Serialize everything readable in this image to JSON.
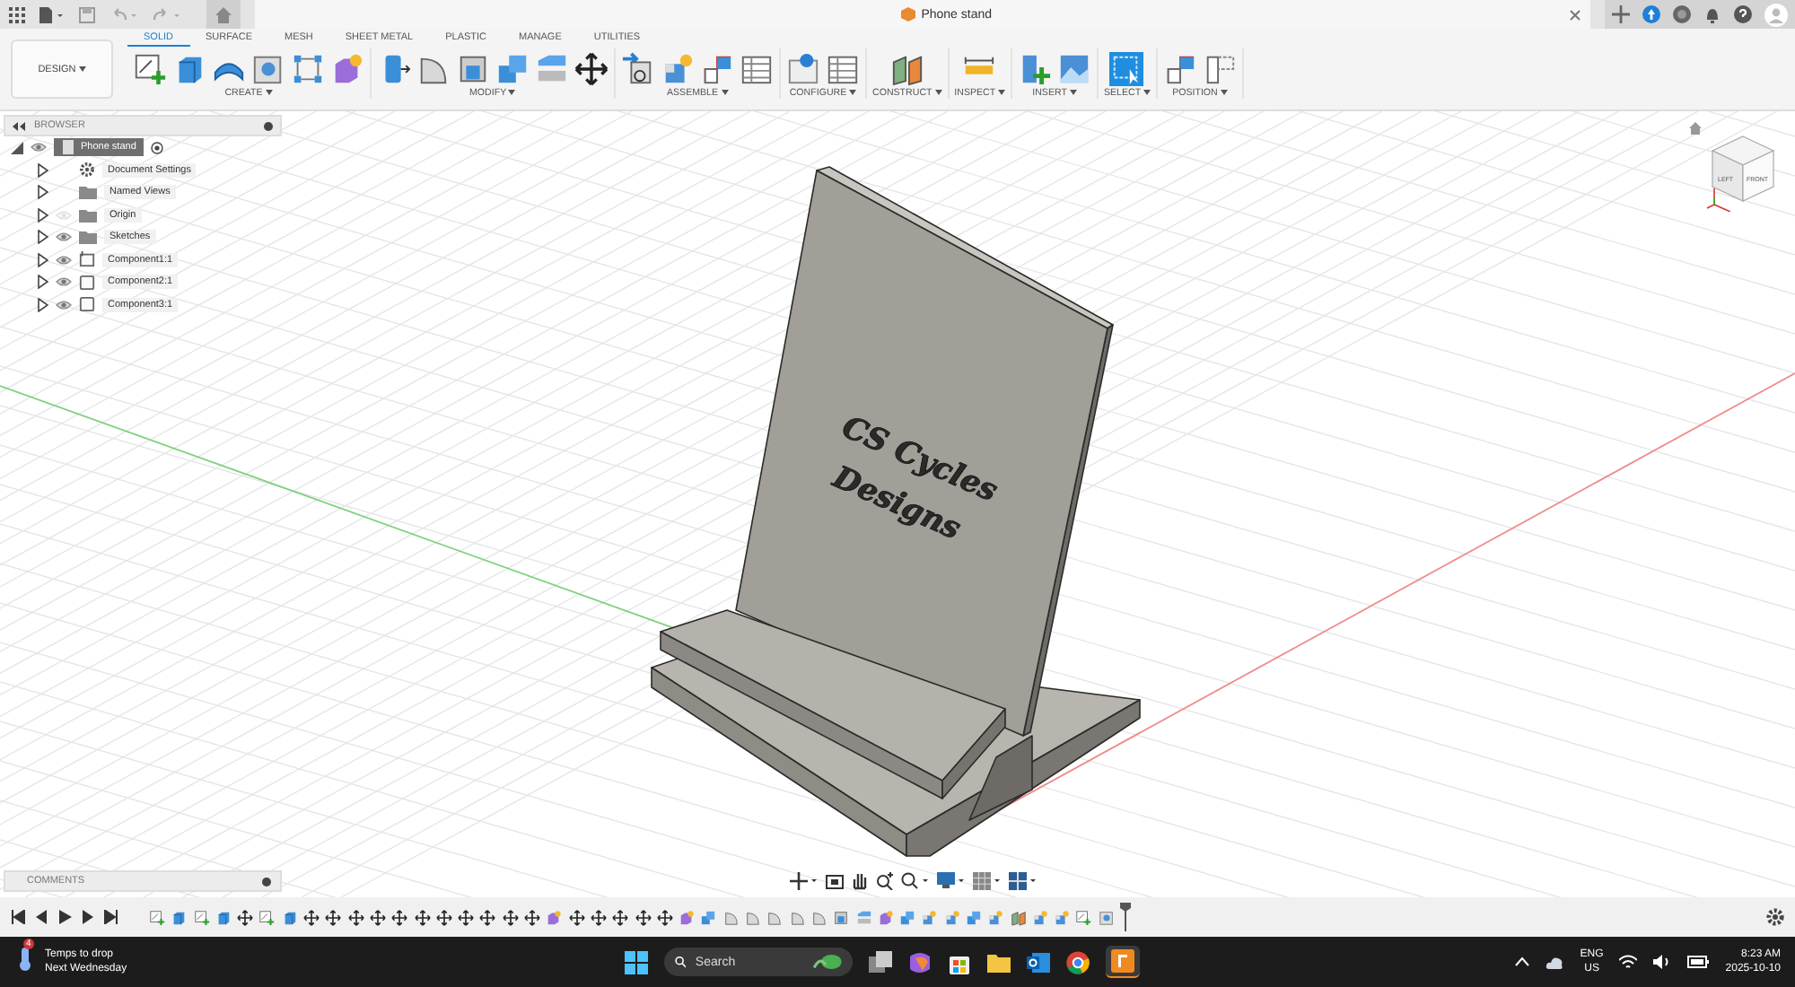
{
  "app_bar": {
    "document_title": "Phone stand"
  },
  "workspace": {
    "label": "DESIGN"
  },
  "tabs": [
    {
      "label": "SOLID",
      "selected": true
    },
    {
      "label": "SURFACE",
      "selected": false
    },
    {
      "label": "MESH",
      "selected": false
    },
    {
      "label": "SHEET METAL",
      "selected": false
    },
    {
      "label": "PLASTIC",
      "selected": false
    },
    {
      "label": "MANAGE",
      "selected": false
    },
    {
      "label": "UTILITIES",
      "selected": false
    }
  ],
  "toolbar_groups": [
    {
      "label": "CREATE",
      "tools": [
        {
          "kind": "sketch"
        },
        {
          "kind": "extrude"
        },
        {
          "kind": "revolve"
        },
        {
          "kind": "hole"
        },
        {
          "kind": "pattern"
        },
        {
          "kind": "form"
        }
      ]
    },
    {
      "label": "MODIFY",
      "tools": [
        {
          "kind": "press"
        },
        {
          "kind": "fillet"
        },
        {
          "kind": "shell"
        },
        {
          "kind": "combine"
        },
        {
          "kind": "split"
        },
        {
          "kind": "move"
        }
      ]
    },
    {
      "label": "ASSEMBLE",
      "tools": [
        {
          "kind": "joint"
        },
        {
          "kind": "component"
        },
        {
          "kind": "layout"
        },
        {
          "kind": "table"
        }
      ]
    },
    {
      "label": "CONFIGURE",
      "tools": [
        {
          "kind": "configure"
        },
        {
          "kind": "table"
        }
      ]
    },
    {
      "label": "CONSTRUCT",
      "tools": [
        {
          "kind": "plane"
        }
      ]
    },
    {
      "label": "INSPECT",
      "tools": [
        {
          "kind": "measure"
        }
      ]
    },
    {
      "label": "INSERT",
      "tools": [
        {
          "kind": "insert"
        },
        {
          "kind": "image"
        }
      ]
    },
    {
      "label": "SELECT",
      "tools": [
        {
          "kind": "select"
        }
      ]
    },
    {
      "label": "POSITION",
      "tools": [
        {
          "kind": "layout"
        },
        {
          "kind": "outline"
        }
      ]
    }
  ],
  "browser": {
    "title": "BROWSER",
    "root": {
      "label": "Phone stand",
      "selected": true,
      "visible": true,
      "children": [
        {
          "label": "Document Settings",
          "kind": "settings",
          "selected": false
        },
        {
          "label": "Named Views",
          "kind": "folder",
          "selected": false
        },
        {
          "label": "Origin",
          "kind": "folder",
          "visible": false,
          "selected": false
        },
        {
          "label": "Sketches",
          "kind": "folder",
          "visible": true,
          "selected": false
        },
        {
          "label": "Component1:1",
          "kind": "linked",
          "visible": true,
          "selected": false
        },
        {
          "label": "Component2:1",
          "kind": "component",
          "visible": true,
          "selected": false
        },
        {
          "label": "Component3:1",
          "kind": "component",
          "visible": true,
          "selected": false
        }
      ]
    }
  },
  "model": {
    "engraving": [
      "CS Cycles",
      "Designs"
    ]
  },
  "view_cube": {
    "left": "LEFT",
    "front": "FRONT"
  },
  "comments": {
    "title": "COMMENTS"
  },
  "timeline": {
    "features": [
      {
        "kind": "sketch"
      },
      {
        "kind": "extrude"
      },
      {
        "kind": "sketch"
      },
      {
        "kind": "extrude"
      },
      {
        "kind": "move"
      },
      {
        "kind": "sketch"
      },
      {
        "kind": "extrude"
      },
      {
        "kind": "move"
      },
      {
        "kind": "move"
      },
      {
        "kind": "move"
      },
      {
        "kind": "move"
      },
      {
        "kind": "move"
      },
      {
        "kind": "move"
      },
      {
        "kind": "move"
      },
      {
        "kind": "move"
      },
      {
        "kind": "move"
      },
      {
        "kind": "move"
      },
      {
        "kind": "move"
      },
      {
        "kind": "form"
      },
      {
        "kind": "move"
      },
      {
        "kind": "move"
      },
      {
        "kind": "move"
      },
      {
        "kind": "move"
      },
      {
        "kind": "move"
      },
      {
        "kind": "form"
      },
      {
        "kind": "combine"
      },
      {
        "kind": "fillet"
      },
      {
        "kind": "fillet"
      },
      {
        "kind": "fillet"
      },
      {
        "kind": "fillet"
      },
      {
        "kind": "fillet"
      },
      {
        "kind": "shell"
      },
      {
        "kind": "split"
      },
      {
        "kind": "form"
      },
      {
        "kind": "combine"
      },
      {
        "kind": "component"
      },
      {
        "kind": "component"
      },
      {
        "kind": "combine"
      },
      {
        "kind": "component"
      },
      {
        "kind": "plane"
      },
      {
        "kind": "component"
      },
      {
        "kind": "component"
      },
      {
        "kind": "sketch"
      },
      {
        "kind": "hole"
      }
    ]
  },
  "taskbar": {
    "weather_badge": "4",
    "weather_title": "Temps to drop",
    "weather_subtitle": "Next Wednesday",
    "search": {
      "placeholder": "Search"
    },
    "language": "ENG",
    "region": "US",
    "time": "8:23 AM",
    "date": "2025-10-10"
  }
}
